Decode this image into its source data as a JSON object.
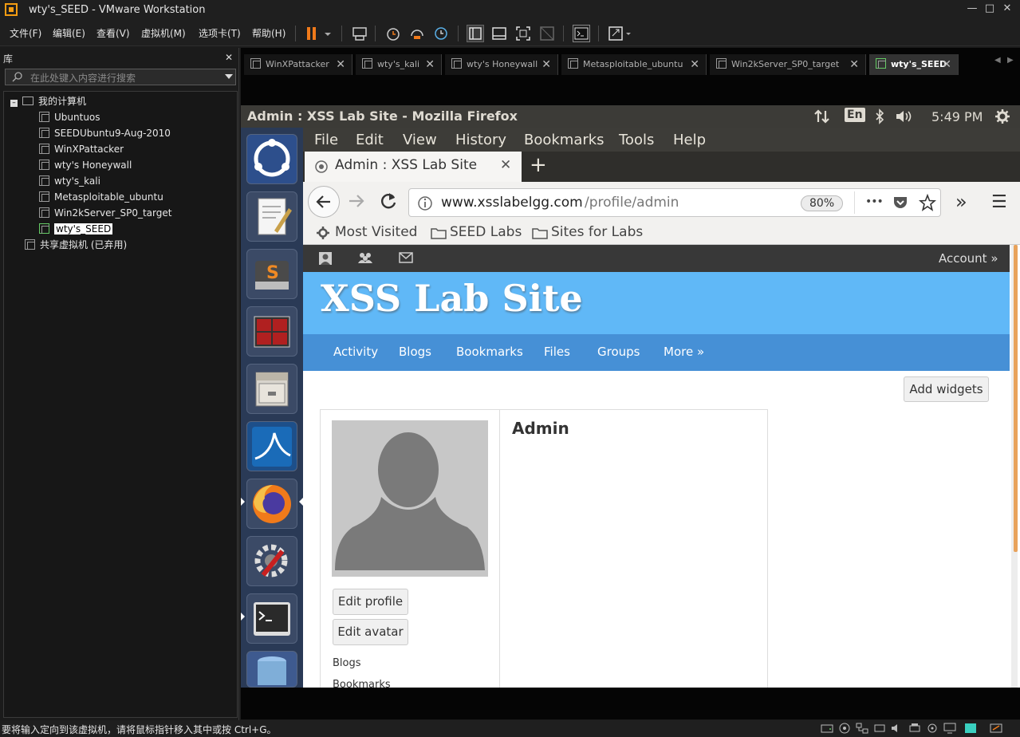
{
  "window": {
    "title": "wty's_SEED - VMware Workstation",
    "controls": [
      "—",
      "□",
      "✕"
    ]
  },
  "menu": [
    "文件(F)",
    "编辑(E)",
    "查看(V)",
    "虚拟机(M)",
    "选项卡(T)",
    "帮助(H)"
  ],
  "toolbar_icons": [
    "pause-icon",
    "dropdown-icon",
    "send-keys-icon",
    "snapshot-icon",
    "revert-snapshot-icon",
    "snapshot-manager-icon",
    "sidebar-toggle-icon",
    "console-view-icon",
    "fullscreen-icon",
    "unity-icon",
    "terminal-icon",
    "stretch-icon"
  ],
  "library": {
    "title": "库",
    "close": "✕",
    "search_placeholder": "在此处键入内容进行搜索",
    "root": "我的计算机",
    "root_toggle": "–",
    "vms": [
      "Ubuntuos",
      "SEEDUbuntu9-Aug-2010",
      "WinXPattacker",
      "wty's Honeywall",
      "wty's_kali",
      "Metasploitable_ubuntu",
      "Win2kServer_SP0_target",
      "wty's_SEED"
    ],
    "selected_vm": "wty's_SEED",
    "shared": "共享虚拟机 (已弃用)"
  },
  "vm_tabs": [
    {
      "label": "WinXPattacker",
      "close": "✕"
    },
    {
      "label": "wty's_kali",
      "close": "✕"
    },
    {
      "label": "wty's Honeywall",
      "close": "✕"
    },
    {
      "label": "Metasploitable_ubuntu",
      "close": "✕"
    },
    {
      "label": "Win2kServer_SP0_target",
      "close": "✕"
    },
    {
      "label": "wty's_SEED",
      "close": "✕",
      "active": true
    }
  ],
  "tab_scroll": [
    "◀",
    "▶"
  ],
  "guest": {
    "window_title": "Admin : XSS Lab Site - Mozilla Firefox",
    "indicators": {
      "keyboard": "En",
      "clock": "5:49 PM"
    },
    "launcher_apps": [
      "ubuntu-dash-icon",
      "text-editor-icon",
      "sublime-text-icon",
      "workspace-switcher-icon",
      "file-manager-icon",
      "wireshark-icon",
      "firefox-icon",
      "system-settings-icon",
      "terminal-icon",
      "trash-icon"
    ],
    "firefox": {
      "menu": [
        "File",
        "Edit",
        "View",
        "History",
        "Bookmarks",
        "Tools",
        "Help"
      ],
      "tab_title": "Admin : XSS Lab Site",
      "tab_close": "✕",
      "new_tab": "+",
      "url_host": "www.xsslabelgg.com",
      "url_path": "/profile/admin",
      "zoom": "80%",
      "more_dots": "•••",
      "overflow": "»",
      "menu_icon": "☰",
      "bookmarks": [
        "Most Visited",
        "SEED Labs",
        "Sites for Labs"
      ]
    },
    "site": {
      "account": "Account »",
      "title": "XSS Lab Site",
      "nav": [
        "Activity",
        "Blogs",
        "Bookmarks",
        "Files",
        "Groups",
        "More »"
      ],
      "add_widgets": "Add widgets",
      "profile_name": "Admin",
      "buttons": [
        "Edit profile",
        "Edit avatar"
      ],
      "links": [
        "Blogs",
        "Bookmarks"
      ]
    }
  },
  "status_bar": "要将输入定向到该虚拟机，请将鼠标指针移入其中或按 Ctrl+G。"
}
